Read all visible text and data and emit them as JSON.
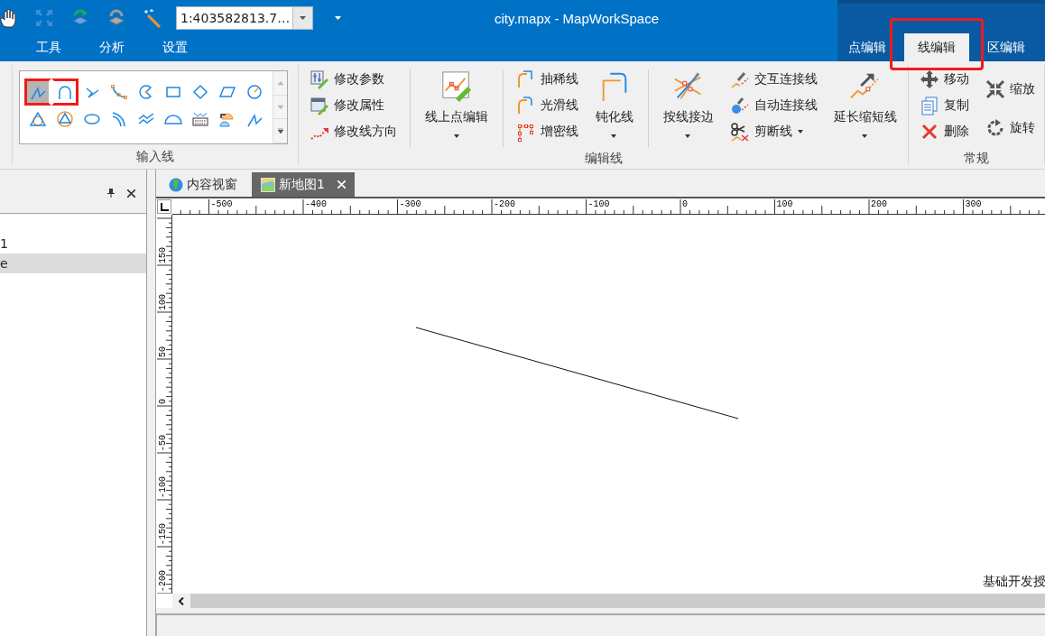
{
  "title_bar": {
    "scale": "1:403582813.7…",
    "title": "city.mapx - MapWorkSpace"
  },
  "menu_tabs": [
    {
      "label": "工具",
      "selected": false
    },
    {
      "label": "分析",
      "selected": false
    },
    {
      "label": "设置",
      "selected": false
    }
  ],
  "editor_tabs": [
    {
      "label": "点编辑",
      "selected": false,
      "highlighted": false
    },
    {
      "label": "线编辑",
      "selected": true,
      "highlighted": true
    },
    {
      "label": "区编辑",
      "selected": false,
      "highlighted": false
    }
  ],
  "ribbon": {
    "groups": [
      {
        "label": "输入线",
        "kind": "gallery",
        "gallery": [
          {
            "selected": true,
            "highlighted": true
          },
          {
            "selected": false,
            "highlighted": true
          },
          {
            "selected": false,
            "highlighted": false
          },
          {
            "selected": false,
            "highlighted": false
          },
          {
            "selected": false,
            "highlighted": false
          },
          {
            "selected": false,
            "highlighted": false
          },
          {
            "selected": false,
            "highlighted": false
          },
          {
            "selected": false,
            "highlighted": false
          },
          {
            "selected": false,
            "highlighted": false
          },
          {
            "selected": false,
            "highlighted": false
          },
          {
            "selected": false,
            "highlighted": false
          },
          {
            "selected": false,
            "highlighted": false
          },
          {
            "selected": false,
            "highlighted": false
          },
          {
            "selected": false,
            "highlighted": false
          },
          {
            "selected": false,
            "highlighted": false
          },
          {
            "selected": false,
            "highlighted": false
          },
          {
            "selected": false,
            "highlighted": false
          },
          {
            "selected": false,
            "highlighted": false
          }
        ]
      },
      {
        "label": "编辑线",
        "kind": "buttons",
        "columns": [
          {
            "kind": "stack",
            "items": [
              {
                "label": "修改参数",
                "dropdown": false
              },
              {
                "label": "修改属性",
                "dropdown": false
              },
              {
                "label": "修改线方向",
                "dropdown": false
              }
            ]
          },
          {
            "kind": "separator"
          },
          {
            "kind": "large",
            "label": "线上点编辑",
            "dropdown": true
          },
          {
            "kind": "separator"
          },
          {
            "kind": "stack",
            "items": [
              {
                "label": "抽稀线",
                "dropdown": false
              },
              {
                "label": "光滑线",
                "dropdown": false
              },
              {
                "label": "增密线",
                "dropdown": false
              }
            ]
          },
          {
            "kind": "large",
            "label": "钝化线",
            "dropdown": true
          },
          {
            "kind": "separator"
          },
          {
            "kind": "large",
            "label": "按线接边",
            "dropdown": true
          },
          {
            "kind": "stack",
            "items": [
              {
                "label": "交互连接线",
                "dropdown": false
              },
              {
                "label": "自动连接线",
                "dropdown": false
              },
              {
                "label": "剪断线",
                "dropdown": true
              }
            ]
          },
          {
            "kind": "large",
            "label": "延长缩短线",
            "dropdown": true
          }
        ]
      },
      {
        "label": "常规",
        "kind": "buttons",
        "columns": [
          {
            "kind": "stack",
            "items": [
              {
                "label": "移动",
                "dropdown": false
              },
              {
                "label": "复制",
                "dropdown": false
              },
              {
                "label": "删除",
                "dropdown": false
              }
            ]
          },
          {
            "kind": "stack",
            "items": [
              {
                "label": "缩放",
                "dropdown": false
              },
              {
                "label": "旋转",
                "dropdown": false
              }
            ]
          }
        ]
      }
    ]
  },
  "side_panel": {
    "tree": [
      {
        "label": "1",
        "selected": false
      },
      {
        "label": "e",
        "selected": true
      }
    ]
  },
  "document_tabs": [
    {
      "label": "内容视窗",
      "selected": false,
      "closable": false
    },
    {
      "label": "新地图1",
      "selected": true,
      "closable": true
    }
  ],
  "map_view": {
    "x_ruler_labels": [
      "-500",
      "-400",
      "-300",
      "-200",
      "-100",
      "0",
      "100",
      "200",
      "300"
    ],
    "y_ruler_labels": [
      "150",
      "100",
      "50",
      "0",
      "-50",
      "-100",
      "-150",
      "-200"
    ],
    "license_text": "基础开发授"
  }
}
